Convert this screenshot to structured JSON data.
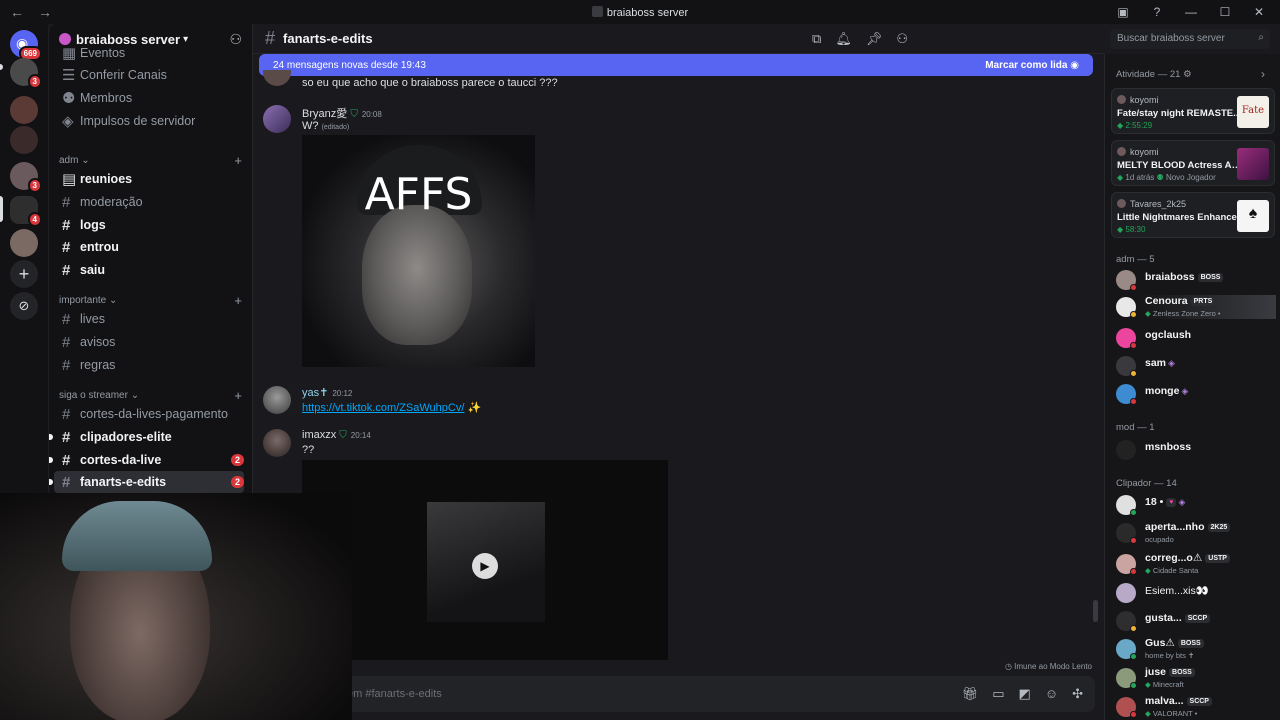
{
  "titlebar": {
    "title": "braiaboss server",
    "back": "←",
    "forward": "→"
  },
  "rail": {
    "home_badge": "669",
    "badges": [
      "3",
      "3",
      "4"
    ]
  },
  "server": {
    "name": "braiaboss server"
  },
  "channels": {
    "top": [
      {
        "label": "Eventos"
      },
      {
        "label": "Conferir Canais"
      },
      {
        "label": "Membros"
      },
      {
        "label": "Impulsos de servidor"
      }
    ],
    "adm_label": "adm",
    "adm": [
      "reunioes",
      "moderação",
      "logs",
      "entrou",
      "saiu"
    ],
    "importante_label": "importante",
    "importante": [
      "lives",
      "avisos",
      "regras"
    ],
    "siga_label": "siga o streamer",
    "siga": [
      "cortes-da-lives-pagamento",
      "clipadores-elite",
      "cortes-da-live",
      "fanarts-e-edits"
    ],
    "counts": {
      "cortes-da-live": "2",
      "fanarts-e-edits": "2"
    }
  },
  "chat": {
    "channel": "fanarts-e-edits",
    "search_placeholder": "Buscar braiaboss server",
    "new_messages": "24 mensagens novas desde 19:43",
    "mark_read": "Marcar como lida",
    "partial_message": "so eu que acho que o braiaboss parece o taucci ???",
    "messages": [
      {
        "author": "Bryanz愛",
        "time": "20:08",
        "text": "W?",
        "edited": "(editado)",
        "image_caption": "AFFS"
      },
      {
        "author": "yas✝",
        "time": "20:12",
        "link": "https://vt.tiktok.com/ZSaWuhpCv/",
        "emoji": "✨"
      },
      {
        "author": "imaxzx",
        "time": "20:14",
        "text": "??"
      }
    ],
    "immune": "Imune ao Modo Lento",
    "composer_placeholder": "em #fanarts-e-edits"
  },
  "members": {
    "activity_header": "Atividade — 21",
    "activities": [
      {
        "user": "koyomi",
        "game": "Fate/stay night REMASTE...",
        "status": "2:55:29",
        "art": "Fate"
      },
      {
        "user": "koyomi",
        "game": "MELTY BLOOD Actress Ag...",
        "status": "1d atrás",
        "extra": "Novo Jogador"
      },
      {
        "user": "Tavares_2k25",
        "game": "Little Nightmares Enhance...",
        "status": "58:30"
      }
    ],
    "adm_header": "adm — 5",
    "adm": [
      {
        "name": "braiaboss",
        "tag": "BOSS"
      },
      {
        "name": "Cenoura",
        "tag": "PRTS",
        "sub": "Zenless Zone Zero •"
      },
      {
        "name": "ogclaush"
      },
      {
        "name": "sam"
      },
      {
        "name": "monge"
      }
    ],
    "mod_header": "mod — 1",
    "mod": [
      {
        "name": "msnboss"
      }
    ],
    "clip_header": "Clipador — 14",
    "clip": [
      {
        "name": "18 •",
        "tag": "♥"
      },
      {
        "name": "aperta...nho",
        "tag": "2K25",
        "sub": "ocupado"
      },
      {
        "name": "correg...o⚠",
        "tag": "USTP",
        "sub": "Cidade Santa"
      },
      {
        "name": "Esiem...xis👀"
      },
      {
        "name": "gusta...",
        "tag": "SCCP"
      },
      {
        "name": "Gus⚠",
        "tag": "BOSS",
        "sub": "home by bts ✝"
      },
      {
        "name": "juse",
        "tag": "BOSS",
        "sub": "Minecraft"
      },
      {
        "name": "malva...",
        "tag": "SCCP",
        "sub": "VALORANT •"
      }
    ]
  },
  "colors": {
    "accent": "#5865f2",
    "danger": "#da373c",
    "online": "#23a55a",
    "link": "#00a8fc"
  }
}
